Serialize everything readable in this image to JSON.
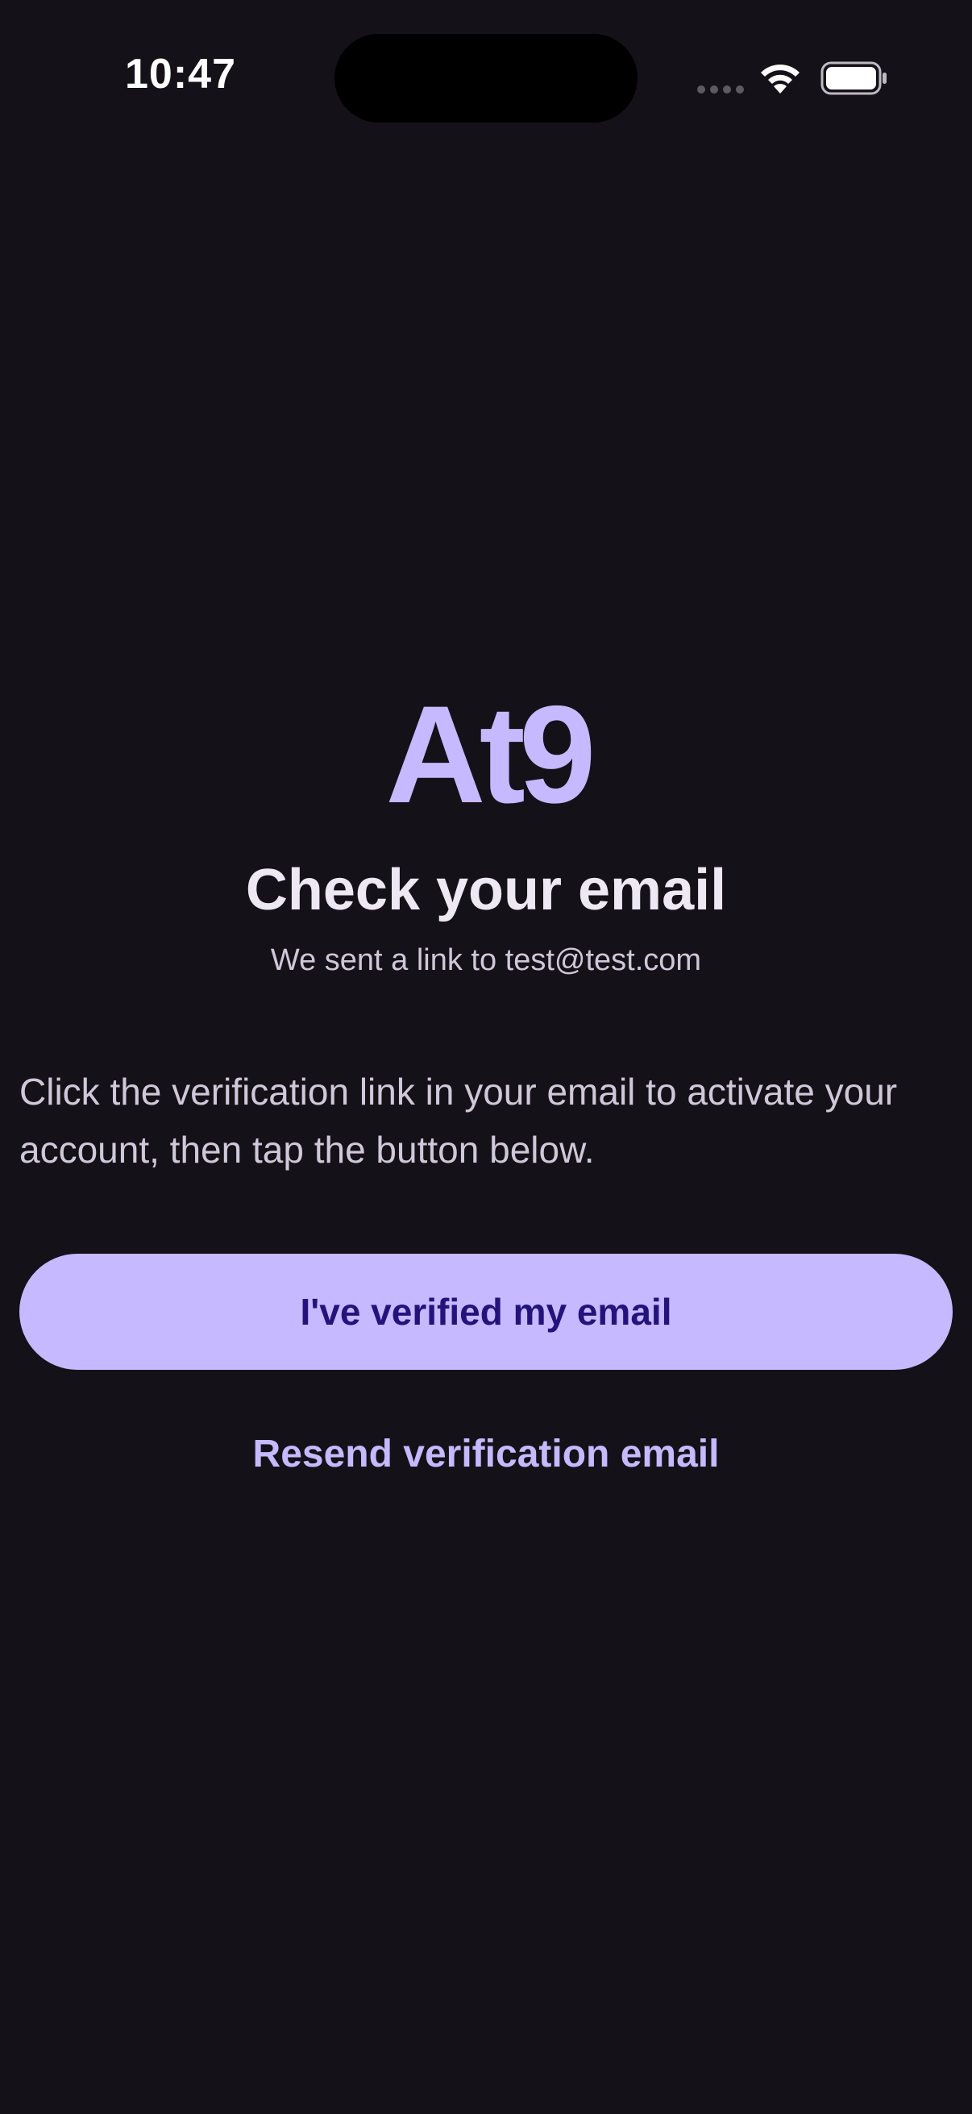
{
  "status_bar": {
    "time": "10:47"
  },
  "logo": {
    "text": "At9",
    "color": "#C6B9FF"
  },
  "content": {
    "title": "Check your email",
    "subtitle": "We sent a link to test@test.com",
    "instructions": "Click the verification link in your email to activate your account, then tap the button below."
  },
  "actions": {
    "primary_label": "I've verified my email",
    "secondary_label": "Resend verification email"
  },
  "colors": {
    "background": "#141118",
    "accent": "#C6B9FF",
    "button_text": "#23137A"
  },
  "icons": [
    "signal-icon",
    "wifi-icon",
    "battery-icon"
  ]
}
